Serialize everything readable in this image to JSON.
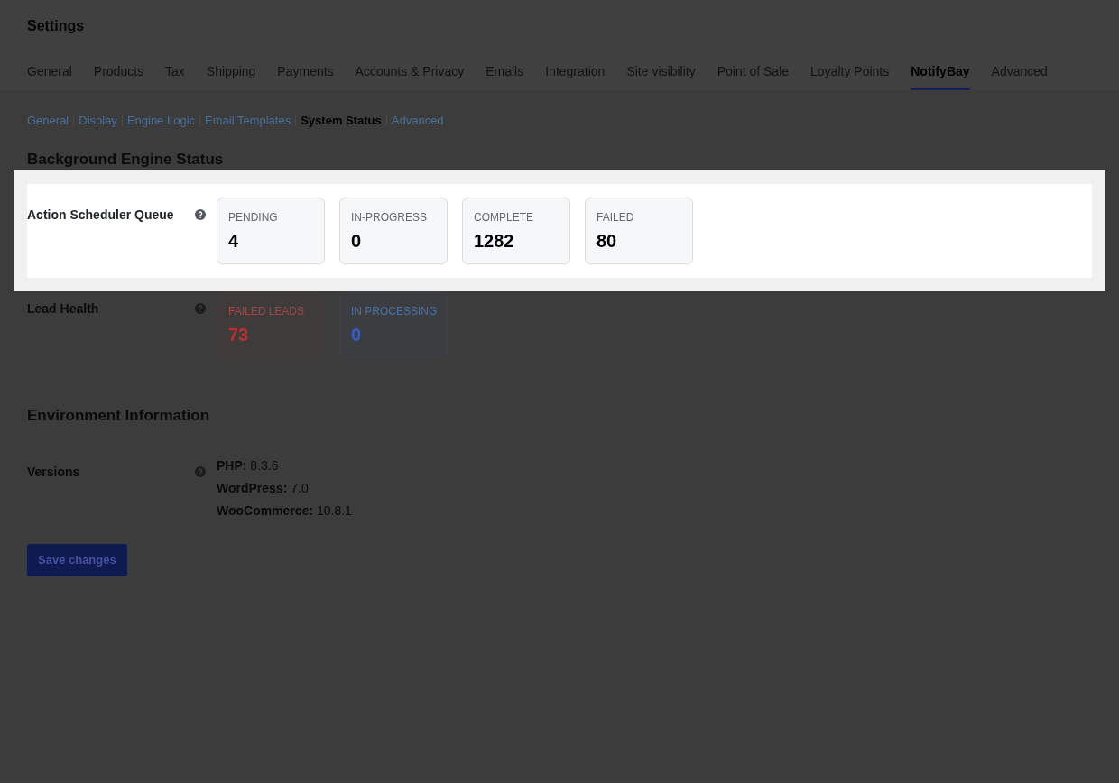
{
  "page_title": "Settings",
  "tabs": [
    {
      "label": "General",
      "selected": false
    },
    {
      "label": "Products",
      "selected": false
    },
    {
      "label": "Tax",
      "selected": false
    },
    {
      "label": "Shipping",
      "selected": false
    },
    {
      "label": "Payments",
      "selected": false
    },
    {
      "label": "Accounts & Privacy",
      "selected": false
    },
    {
      "label": "Emails",
      "selected": false
    },
    {
      "label": "Integration",
      "selected": false
    },
    {
      "label": "Site visibility",
      "selected": false
    },
    {
      "label": "Point of Sale",
      "selected": false
    },
    {
      "label": "Loyalty Points",
      "selected": false
    },
    {
      "label": "NotifyBay",
      "selected": true
    },
    {
      "label": "Advanced",
      "selected": false
    }
  ],
  "sub_nav": [
    {
      "label": "General",
      "selected": false
    },
    {
      "label": "Display",
      "selected": false
    },
    {
      "label": "Engine Logic",
      "selected": false
    },
    {
      "label": "Email Templates",
      "selected": false
    },
    {
      "label": "System Status",
      "selected": true
    },
    {
      "label": "Advanced",
      "selected": false
    }
  ],
  "sections": [
    {
      "heading": "Background Engine Status",
      "rows": [
        {
          "label": "Action Scheduler Queue",
          "highlighted": true,
          "kind": "stats",
          "cards": [
            {
              "kind": "neutral",
              "label": "PENDING",
              "value": "4"
            },
            {
              "kind": "neutral",
              "label": "IN-PROGRESS",
              "value": "0"
            },
            {
              "kind": "neutral",
              "label": "COMPLETE",
              "value": "1282"
            },
            {
              "kind": "neutral",
              "label": "FAILED",
              "value": "80"
            }
          ]
        },
        {
          "label": "Lead Health",
          "highlighted": false,
          "kind": "stats",
          "cards": [
            {
              "kind": "error",
              "label": "FAILED LEADS",
              "value": "73"
            },
            {
              "kind": "info",
              "label": "IN PROCESSING",
              "value": "0"
            }
          ]
        }
      ]
    },
    {
      "heading": "Environment Information",
      "rows": [
        {
          "label": "Versions",
          "highlighted": false,
          "kind": "list",
          "lines": [
            "**PHP:** 8.3.6",
            "**WordPress:** 7.0",
            "**WooCommerce:** 10.8.1"
          ]
        }
      ]
    }
  ],
  "save_button": {
    "label": "Save changes"
  }
}
